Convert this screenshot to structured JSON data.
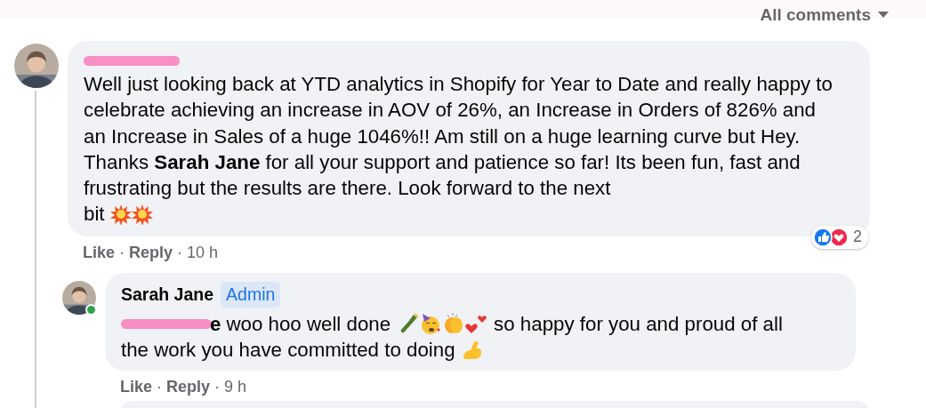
{
  "header": {
    "sort_label": "All comments"
  },
  "comments": [
    {
      "author_redacted": true,
      "body_rows": [
        [
          {
            "kind": "text",
            "text": "Well just looking back at YTD analytics in Shopify for Year to Date and really happy to celebrate achieving an increase in AOV of 26%, an Increase in Orders of 826% and an Increase in Sales of a huge 1046%!! Am still on a huge learning curve but Hey. Thanks **Sarah Jane** for all your support and patience so far! Its been fun, fast and frustrating but the results are there. Look forward to the next"
          }
        ],
        [
          {
            "kind": "text",
            "text": "bit"
          },
          {
            "kind": "emoji"
          },
          {
            "kind": "emoji"
          }
        ]
      ],
      "reaction_count": "2",
      "actions": [
        "Like",
        "Reply"
      ],
      "separator": "·",
      "time": "10 h",
      "replies": [
        {
          "author": "Sarah Jane",
          "badge": "Admin",
          "body_rows": [
            [
              {
                "kind": "mention",
                "text": "e",
                "redacted": true
              },
              {
                "kind": "text",
                "text": "woo hoo well done"
              },
              {
                "kind": "emoji"
              },
              {
                "kind": "emoji"
              },
              {
                "kind": "emoji"
              },
              {
                "kind": "emoji"
              },
              {
                "kind": "text",
                "text": "so happy for you and proud of all"
              }
            ],
            [
              {
                "kind": "text",
                "text": "the work you have committed to doing"
              },
              {
                "kind": "emoji"
              }
            ]
          ],
          "actions": [
            "Like",
            "Reply"
          ],
          "separator": "·",
          "time": "9 h",
          "online": true
        }
      ]
    }
  ]
}
